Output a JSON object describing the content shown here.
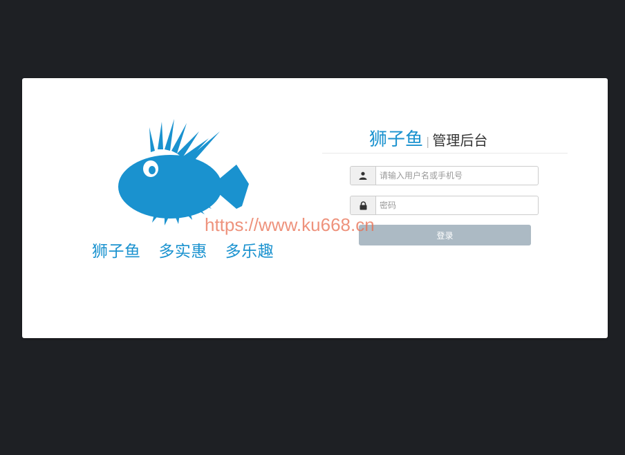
{
  "brand": {
    "slogan_parts": [
      "狮子鱼",
      "多实惠",
      "多乐趣"
    ],
    "logo_icon": "lionfish-logo"
  },
  "login": {
    "title_brand": "狮子鱼",
    "title_separator": "|",
    "title_sub": "管理后台",
    "username": {
      "icon": "user-icon",
      "placeholder": "请输入用户名或手机号",
      "value": ""
    },
    "password": {
      "icon": "lock-icon",
      "placeholder": "密码",
      "value": ""
    },
    "submit_label": "登录"
  },
  "watermark": "https://www.ku668.cn",
  "colors": {
    "background": "#1e2024",
    "accent": "#1a92cf",
    "button": "#acbac4"
  }
}
